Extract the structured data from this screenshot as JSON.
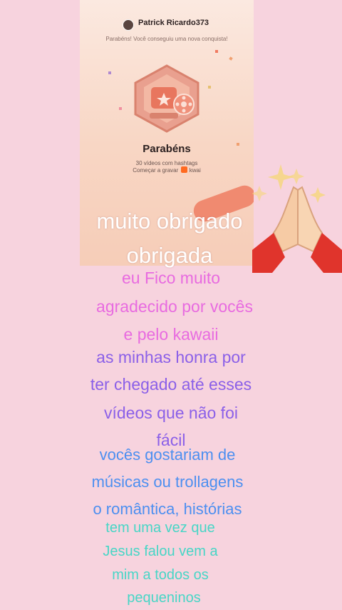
{
  "card": {
    "username": "Patrick Ricardo373",
    "subtitle": "Parabéns! Você conseguiu uma nova conquista!",
    "title": "Parabéns",
    "achievement": "30 vídeos com hashtags",
    "cta_prefix": "Começar a gravar",
    "brand": "kwai"
  },
  "overlay": {
    "line1": "muito obrigado",
    "line2": "obrigada"
  },
  "text_blocks": {
    "pink": [
      "eu Fico muito",
      "agradecido por vocês",
      "e pelo kawaii"
    ],
    "purple": [
      "as minhas honra por",
      "ter chegado até esses",
      "vídeos que não foi",
      "fácil"
    ],
    "blue": [
      "vocês gostariam de",
      "músicas ou trollagens",
      "o romântica, histórias"
    ],
    "teal": [
      "tem uma vez que",
      "Jesus falou vem a",
      "mim a todos os",
      "pequeninos"
    ]
  },
  "colors": {
    "background": "#f7d3de",
    "pink": "#e86be0",
    "purple": "#8b60e8",
    "blue": "#4c8ff0",
    "teal": "#47d6c6"
  },
  "icons": [
    "user-avatar",
    "achievement-medal-icon",
    "kwai-logo-icon",
    "praying-hands-emoji"
  ]
}
